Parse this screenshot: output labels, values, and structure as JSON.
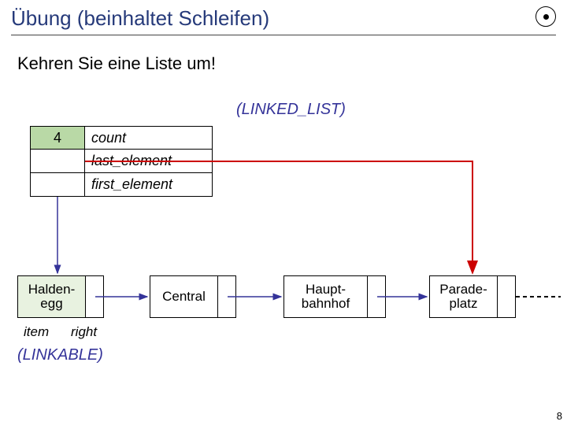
{
  "title": "Übung (beinhaltet Schleifen)",
  "subtitle": "Kehren Sie eine Liste um!",
  "labels": {
    "linked_list": "(LINKED_LIST)",
    "linkable": "(LINKABLE)",
    "item": "item",
    "right": "right"
  },
  "header": {
    "count_value": "4",
    "fields": {
      "count": "count",
      "last_element": "last_element",
      "first_element": "first_element"
    }
  },
  "nodes": [
    {
      "item": "Halden-\negg"
    },
    {
      "item": "Central"
    },
    {
      "item": "Haupt-\nbahnhof"
    },
    {
      "item": "Parade-\nplatz"
    }
  ],
  "page_number": "8",
  "chart_data": {
    "type": "table",
    "description": "Linked list diagram",
    "object": {
      "class": "LINKED_LIST",
      "count": 4,
      "first_element": "Haldenegg",
      "last_element": "Paradeplatz"
    },
    "node_class": "LINKABLE",
    "node_fields": [
      "item",
      "right"
    ],
    "sequence": [
      "Haldenegg",
      "Central",
      "Hauptbahnhof",
      "Paradeplatz"
    ]
  }
}
